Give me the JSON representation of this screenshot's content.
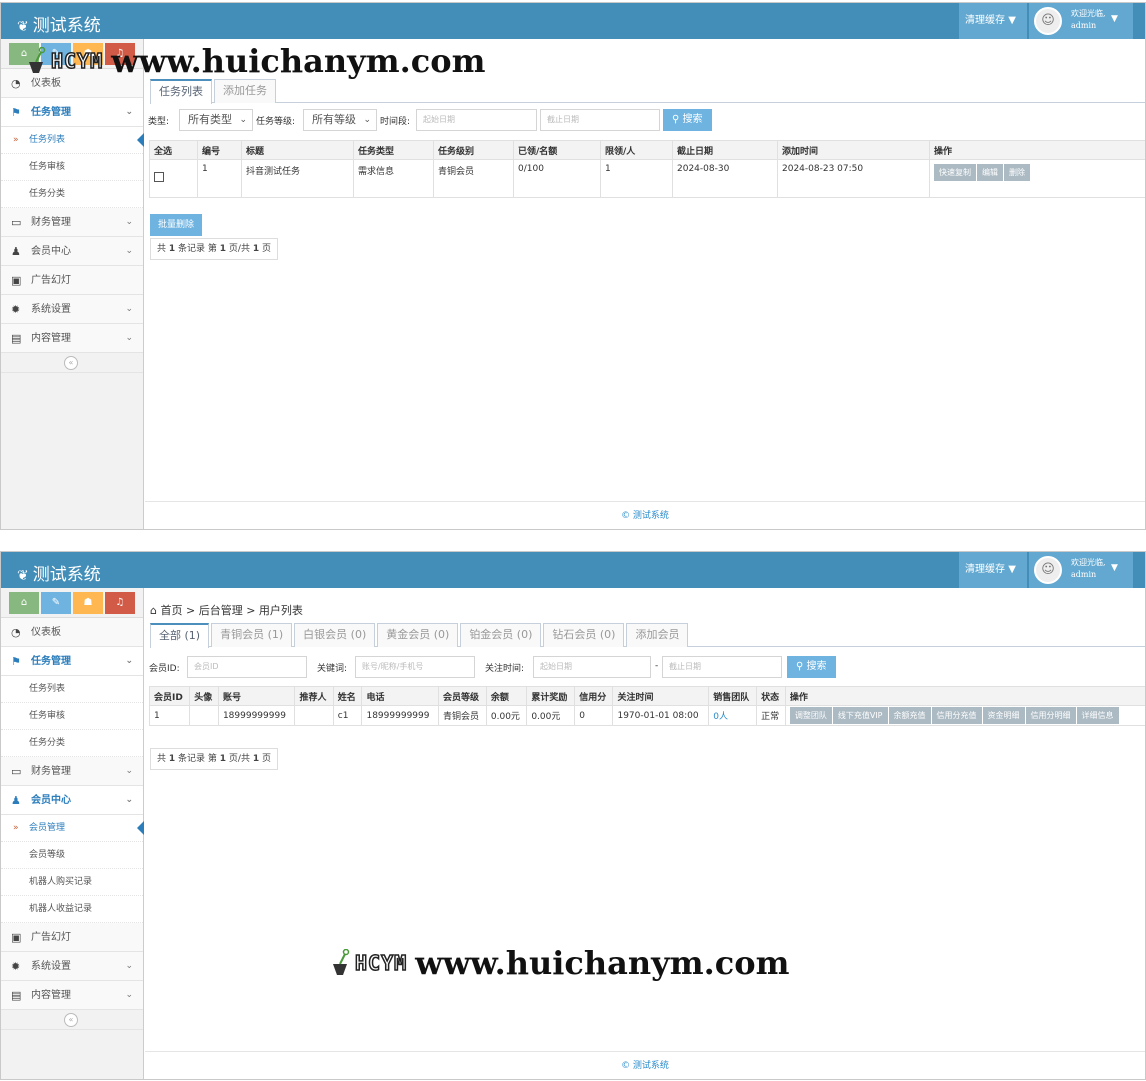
{
  "common": {
    "app_title": "测试系统",
    "clear_cache": "清理缓存",
    "welcome": "欢迎光临,",
    "username": "admin",
    "footer": "© 测试系统",
    "colors": {
      "topbar": "#438eb9",
      "accent": "#2b7dbc",
      "search_button": "#6fb3e0"
    },
    "shortcut_icons": [
      "home-icon",
      "pencil-icon",
      "users-icon",
      "bell-icon"
    ]
  },
  "sidebar": {
    "dashboard": "仪表板",
    "task_mgmt": "任务管理",
    "task_list": "任务列表",
    "task_review": "任务审核",
    "task_category": "任务分类",
    "finance": "财务管理",
    "member_center": "会员中心",
    "member_mgmt": "会员管理",
    "member_level": "会员等级",
    "robot_purchase": "机器人购买记录",
    "robot_income": "机器人收益记录",
    "ads": "广告幻灯",
    "system_settings": "系统设置",
    "content_mgmt": "内容管理"
  },
  "task_page": {
    "tabs": [
      "任务列表",
      "添加任务"
    ],
    "filters": {
      "type_label": "类型:",
      "type_value": "所有类型",
      "level_label": "任务等级:",
      "level_value": "所有等级",
      "period_label": "时间段:",
      "start_placeholder": "起始日期",
      "end_placeholder": "截止日期",
      "search": "搜索"
    },
    "columns": [
      "全选",
      "编号",
      "标题",
      "任务类型",
      "任务级别",
      "已领/名额",
      "限领/人",
      "截止日期",
      "添加时间",
      "操作"
    ],
    "row": {
      "id": "1",
      "title": "抖音测试任务",
      "type": "需求信息",
      "level": "青铜会员",
      "claimed": "0/100",
      "limit": "1",
      "deadline": "2024-08-30",
      "added": "2024-08-23 07:50"
    },
    "actions": [
      "快速复制",
      "编辑",
      "删除"
    ],
    "batch_delete": "批量删除",
    "pager": {
      "prefix": "共",
      "count": "1",
      "mid": "条记录 第",
      "page": "1",
      "slash": "页/共",
      "total": "1",
      "suffix": "页"
    }
  },
  "member_page": {
    "breadcrumb": {
      "home": "首页",
      "sep1": ">",
      "section": "后台管理",
      "sep2": ">",
      "page": "用户列表"
    },
    "tabs": [
      "全部 (1)",
      "青铜会员 (1)",
      "白银会员 (0)",
      "黄金会员 (0)",
      "铂金会员 (0)",
      "钻石会员 (0)",
      "添加会员"
    ],
    "filters": {
      "id_label": "会员ID:",
      "id_placeholder": "会员ID",
      "keyword_label": "关键词:",
      "keyword_placeholder": "账号/昵称/手机号",
      "time_label": "关注时间:",
      "start_placeholder": "起始日期",
      "dash": "-",
      "end_placeholder": "截止日期",
      "search": "搜索"
    },
    "columns": [
      "会员ID",
      "头像",
      "账号",
      "推荐人",
      "姓名",
      "电话",
      "会员等级",
      "余额",
      "累计奖励",
      "信用分",
      "关注时间",
      "销售团队",
      "状态",
      "操作"
    ],
    "row": {
      "id": "1",
      "avatar": "",
      "account": "18999999999",
      "referrer": "",
      "name": "c1",
      "phone": "18999999999",
      "level": "青铜会员",
      "balance": "0.00元",
      "reward": "0.00元",
      "credit": "0",
      "followed": "1970-01-01 08:00",
      "team": "0人",
      "status": "正常"
    },
    "actions": [
      "调整团队",
      "线下充值VIP",
      "余额充值",
      "信用分充值",
      "资金明细",
      "信用分明细",
      "详细信息"
    ],
    "pager": {
      "prefix": "共",
      "count": "1",
      "mid": "条记录 第",
      "page": "1",
      "slash": "页/共",
      "total": "1",
      "suffix": "页"
    }
  },
  "watermark": {
    "logo": "HCYM",
    "url": "www.huichanym.com"
  }
}
